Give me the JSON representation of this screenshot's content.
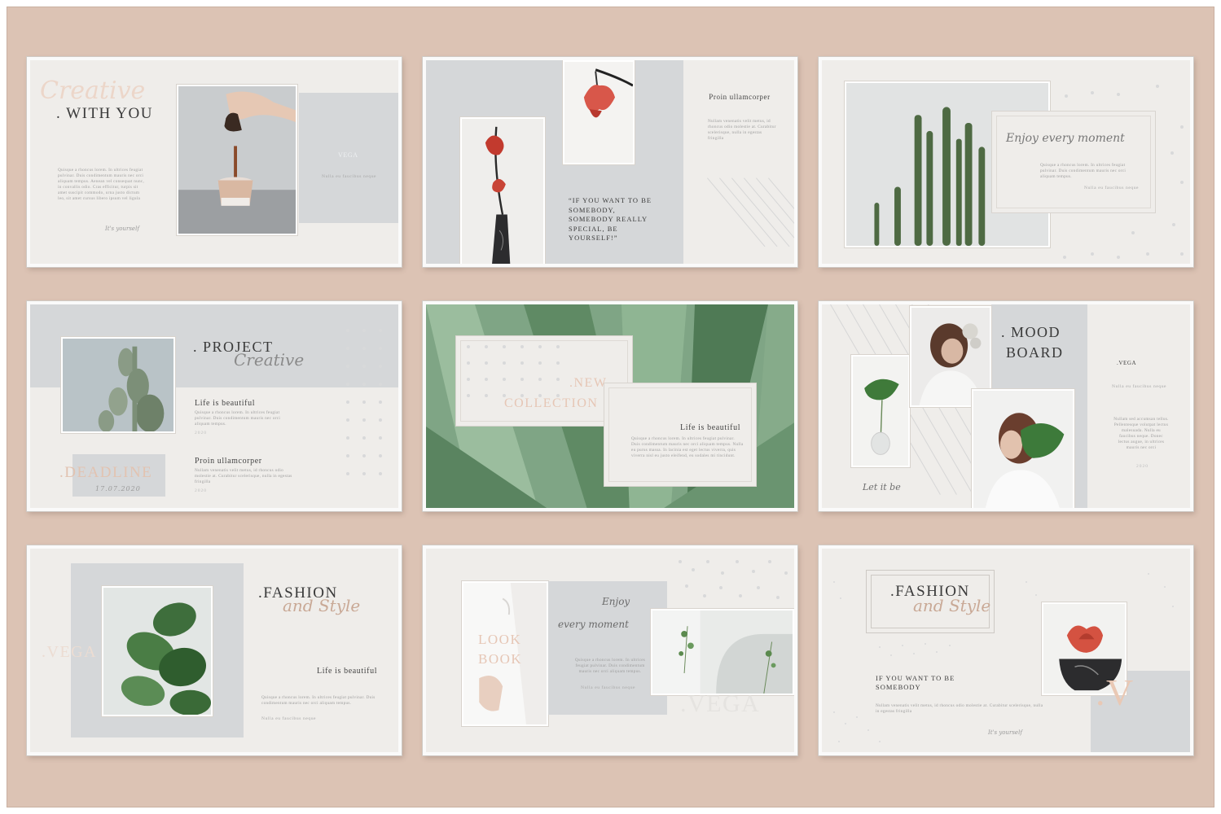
{
  "slides": {
    "s1": {
      "script": "Creative",
      "title": ". WITH YOU",
      "body": "Quisque a rhoncus lorem. In ultrices feugiat pulvinar. Duis condimentum mauris nec orci aliquam tempus. Aenean vel consequat nunc, in convallis odio. Cras efficitur, turpis sit amet suscipit commodo, urna justo dictum leo, sit amet cursus libero ipsum vel ligula",
      "signature": "It's yourself",
      "vega": "VEGA",
      "vega_sub": "Nulla eu faucibus neque"
    },
    "s2": {
      "title": "Proin ullamcorper",
      "body": "Nullam venenatis velit metus, id rhoncus odio molestie at. Curabitur scelerisque, nulla in egestas fringilla",
      "quote": "“IF YOU WANT TO BE SOMEBODY, SOMEBODY REALLY SPECIAL, BE YOURSELF!”"
    },
    "s3": {
      "script": "Enjoy every moment",
      "body": "Quisque a rhoncus lorem. In ultrices feugiat pulvinar. Duis condimentum mauris nec orci aliquam tempus.",
      "sub": "Nulla eu faucibus neque"
    },
    "s4": {
      "title": ". PROJECT",
      "script": "Creative",
      "h1": "Life is beautiful",
      "b1": "Quisque a rhoncus lorem. In ultrices feugiat pulvinar. Duis condimentum mauris nec orci aliquam tempus.",
      "y1": "2020",
      "h2": "Proin ullamcorper",
      "b2": "Nullam venenatis velit metus, id rhoncus odio molestie at. Curabitur scelerisque, nulla in egestas fringilla",
      "y2": "2020",
      "deadline": ".DEADLINE",
      "date": "17.07.2020"
    },
    "s5": {
      "new": ".NEW",
      "collection": "COLLECTION",
      "h": "Life is beautiful",
      "body": "Quisque a rhoncus lorem. In ultrices feugiat pulvinar. Duis condimentum mauris nec orci aliquam tempus. Nulla eu purus massa. In lacinia est eget lectus viverra, quis viverra nisl eu justo eleifend, eu sodales mi tincidunt."
    },
    "s6": {
      "mood": ". MOOD",
      "board": "BOARD",
      "vega": ".VEGA",
      "sub": "Nulla eu faucibus neque",
      "body": "Nullam sed accumsan tellus. Pellentesque volutpat lectus malesuada. Nulla eu faucibus neque. Donec lectus augue, in ultrices mauris nec orci",
      "year": "2020",
      "script": "Let it be"
    },
    "s7": {
      "title": ".FASHION",
      "script": "and Style",
      "vega": ".VEGA",
      "h": "Life is beautiful",
      "body": "Quisque a rhoncus lorem. In ultrices feugiat pulvinar. Duis condimentum mauris nec orci aliquam tempus.",
      "sub": "Nulla eu faucibus neque"
    },
    "s8": {
      "look": "LOOK",
      "book": "BOOK",
      "script1": "Enjoy",
      "script2": "every moment",
      "body": "Quisque a rhoncus lorem. In ultrices feugiat pulvinar. Duis condimentum mauris nec orci aliquam tempus.",
      "sub": "Nulla eu faucibus neque",
      "vega": ".VEGA"
    },
    "s9": {
      "title": ".FASHION",
      "script": "and Style",
      "h": "IF YOU WANT TO BE SOMEBODY",
      "body": "Nullam venenatis velit metus, id rhoncus odio molestie at. Curabitur scelerisque, nulla in egestas fringilla",
      "signature": "It's yourself",
      "v": ".V"
    }
  }
}
